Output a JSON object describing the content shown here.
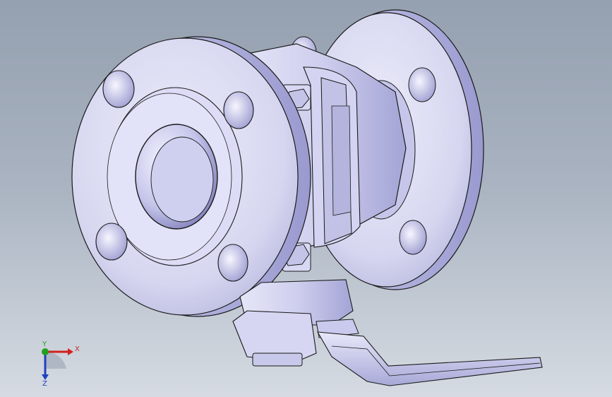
{
  "triad": {
    "x_label": "X",
    "y_label": "Y",
    "z_label": "Z",
    "x_color": "#d22020",
    "y_color": "#20a020",
    "z_color": "#2040c0"
  },
  "colors": {
    "part_fill": "#dcdcf4",
    "part_shade": "#b8b8e0",
    "part_dark": "#8c8cc4",
    "edge": "#1a1a1a"
  }
}
